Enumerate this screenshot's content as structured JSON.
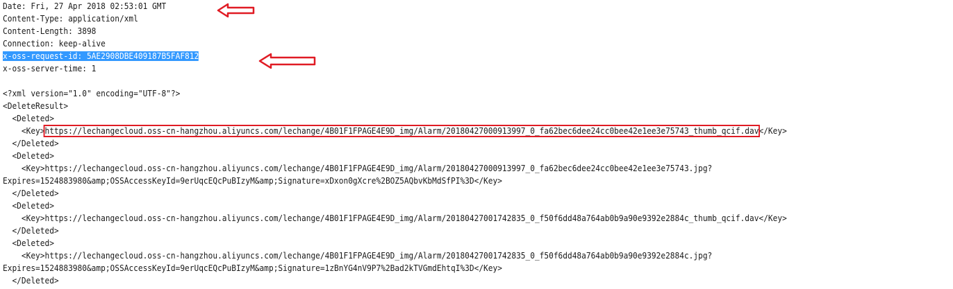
{
  "headers": {
    "date": "Date: Fri, 27 Apr 2018 02:53:01 GMT",
    "content_type": "Content-Type: application/xml",
    "content_length": "Content-Length: 3898",
    "connection": "Connection: keep-alive",
    "request_id": "x-oss-request-id: 5AE2908DBE409187B5FAF812",
    "server_time": "x-oss-server-time: 1"
  },
  "xml": {
    "declaration": "<?xml version=\"1.0\" encoding=\"UTF-8\"?>",
    "root_open": "<DeleteResult>",
    "deleted_open": "<Deleted>",
    "deleted_close": "</Deleted>",
    "key_open": "<Key>",
    "key_close": "</Key>",
    "key1": "https://lechangecloud.oss-cn-hangzhou.aliyuncs.com/lechange/4B01F1FPAGE4E9D_img/Alarm/20180427000913997_0_fa62bec6dee24cc0bee42e1ee3e75743_thumb_qcif.dav",
    "key2_a": "https://lechangecloud.oss-cn-hangzhou.aliyuncs.com/lechange/4B01F1FPAGE4E9D_img/Alarm/20180427000913997_0_fa62bec6dee24cc0bee42e1ee3e75743.jpg?",
    "key2_b": "Expires=1524883980&amp;OSSAccessKeyId=9erUqcEQcPuBIzyM&amp;Signature=xDxon0gXcre%2BOZ5AQbvKbMdSfPI%3D",
    "key3": "https://lechangecloud.oss-cn-hangzhou.aliyuncs.com/lechange/4B01F1FPAGE4E9D_img/Alarm/20180427001742835_0_f50f6dd48a764ab0b9a90e9392e2884c_thumb_qcif.dav",
    "key4_a": "https://lechangecloud.oss-cn-hangzhou.aliyuncs.com/lechange/4B01F1FPAGE4E9D_img/Alarm/20180427001742835_0_f50f6dd48a764ab0b9a90e9392e2884c.jpg?",
    "key4_b": "Expires=1524883980&amp;OSSAccessKeyId=9erUqcEQcPuBIzyM&amp;Signature=1zBnYG4nV9P7%2Bad2kTVGmdEhtqI%3D"
  },
  "colors": {
    "annotation": "#e01b24",
    "selection": "#3399ff"
  },
  "icons": {
    "arrow_date": "left-arrow-annotation-icon",
    "arrow_request_id": "left-arrow-annotation-icon"
  }
}
